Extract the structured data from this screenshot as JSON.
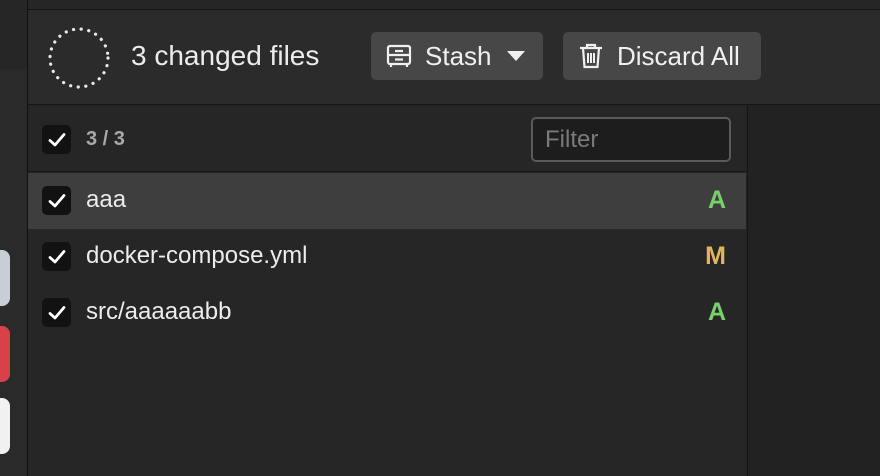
{
  "toolbar": {
    "changed_title": "3 changed files",
    "stash_label": "Stash",
    "discard_label": "Discard All",
    "icons": {
      "spinner": "loading-spinner-icon",
      "stash": "stash-box-icon",
      "caret": "chevron-down-icon",
      "discard": "trash-icon"
    }
  },
  "list": {
    "count_label": "3 / 3",
    "filter_placeholder": "Filter",
    "files": [
      {
        "name": "aaa",
        "status": "A",
        "checked": true,
        "selected": true
      },
      {
        "name": "docker-compose.yml",
        "status": "M",
        "checked": true,
        "selected": false
      },
      {
        "name": "src/aaaaaabb",
        "status": "A",
        "checked": true,
        "selected": false
      }
    ]
  },
  "colors": {
    "added": "#78d06a",
    "modified": "#e0b659",
    "selected_row": "#3e3e3e",
    "button_bg": "#474747"
  }
}
